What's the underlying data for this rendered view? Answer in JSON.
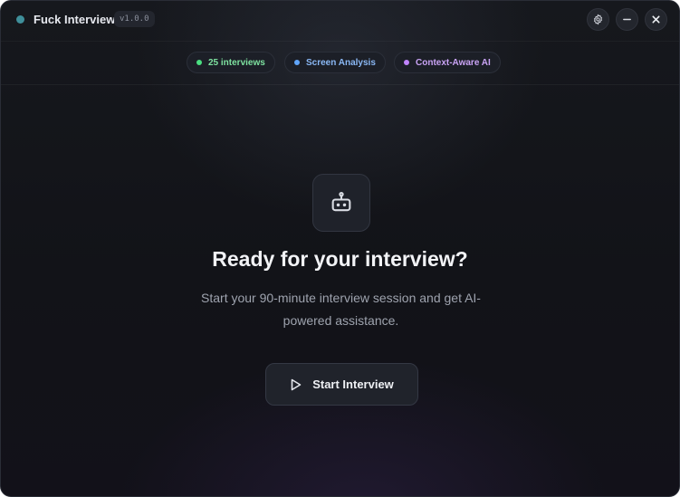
{
  "app": {
    "title": "Fuck Interview",
    "version": "v1.0.0"
  },
  "window_controls": {
    "settings_icon": "gear-icon",
    "minimize_icon": "minus-icon",
    "close_icon": "close-icon"
  },
  "chips": [
    {
      "label": "25 interviews",
      "color": "#4ade80"
    },
    {
      "label": "Screen Analysis",
      "color": "#60a5fa"
    },
    {
      "label": "Context-Aware AI",
      "color": "#c084fc"
    }
  ],
  "hero": {
    "icon": "robot-icon",
    "headline": "Ready for your interview?",
    "subtext": "Start your 90-minute interview session and get AI-powered assistance."
  },
  "actions": {
    "start_label": "Start Interview",
    "start_icon": "play-icon"
  },
  "colors": {
    "background": "#131419",
    "app_dot": "#3f8f9a"
  }
}
